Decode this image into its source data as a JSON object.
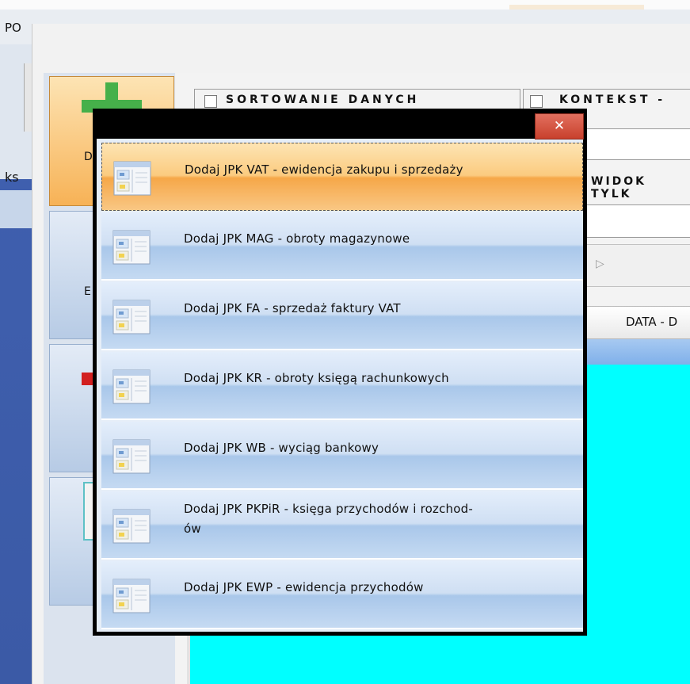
{
  "menubar": {
    "po_label": "PO"
  },
  "left": {
    "ks_label": "ks"
  },
  "buttons": {
    "d_fragment": "D",
    "e_fragment": "E"
  },
  "options": {
    "sort_label": "SORTOWANIE DANYCH",
    "context_label": "KONTEKST -",
    "view_label": "WIDOK TYLK"
  },
  "grid": {
    "date_header": "DATA - D"
  },
  "dialog": {
    "close_symbol": "✕",
    "items": [
      {
        "label": "Dodaj JPK VAT - ewidencja zakupu i sprzedaży",
        "selected": true
      },
      {
        "label": "Dodaj JPK MAG - obroty magazynowe"
      },
      {
        "label": "Dodaj JPK FA - sprzedaż faktury VAT"
      },
      {
        "label": "Dodaj JPK KR - obroty księgą rachunkowych"
      },
      {
        "label": "Dodaj JPK WB - wyciąg bankowy"
      },
      {
        "label_line1": "Dodaj JPK PKPiR - księga przychodów i rozchod-",
        "label_line2": "ów"
      },
      {
        "label": "Dodaj JPK EWP - ewidencja przychodów"
      }
    ]
  },
  "colors": {
    "selected_item": "#f6a748",
    "item_blue": "#a9c7ea",
    "grid_cyan": "#00ffff",
    "close_red": "#c8402c",
    "add_green": "#46b04a"
  },
  "icons": {
    "item_icon": "window-form-icon",
    "close_icon": "close-icon",
    "add_icon": "plus-icon"
  }
}
